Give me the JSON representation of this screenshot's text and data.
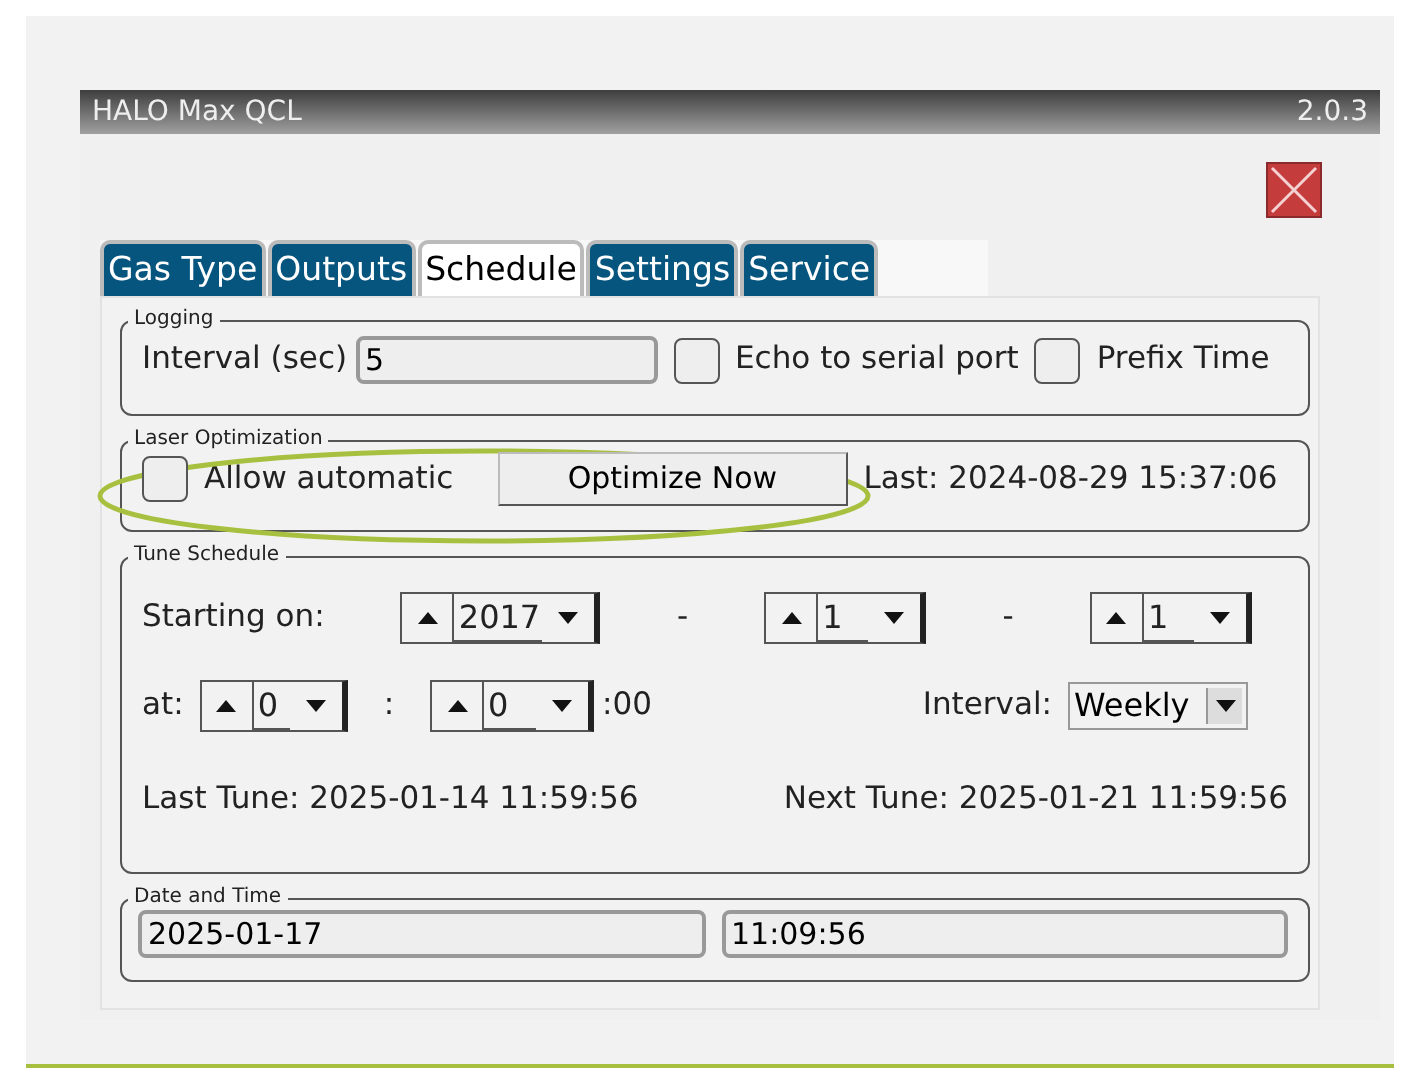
{
  "window": {
    "title": "HALO Max QCL",
    "version": "2.0.3"
  },
  "tabs": [
    {
      "label": "Gas Type",
      "selected": false
    },
    {
      "label": "Outputs",
      "selected": false
    },
    {
      "label": "Schedule",
      "selected": true
    },
    {
      "label": "Settings",
      "selected": false
    },
    {
      "label": "Service",
      "selected": false
    }
  ],
  "logging": {
    "title": "Logging",
    "interval_label": "Interval (sec)",
    "interval_value": "5",
    "options": [
      {
        "label": "Echo to serial port",
        "checked": false
      },
      {
        "label": "Prefix Time",
        "checked": false
      }
    ]
  },
  "laser_optimization": {
    "title": "Laser Optimization",
    "allow_automatic": {
      "label": "Allow automatic",
      "checked": false
    },
    "button": "Optimize Now",
    "last": "Last: 2024-08-29 15:37:06",
    "circled": true
  },
  "tune_schedule": {
    "title": "Tune Schedule",
    "starting_label": "Starting on:",
    "date_spinners": [
      "2017",
      "1",
      "1"
    ],
    "date_separators": [
      "-",
      "-"
    ],
    "at_label": "at:",
    "time_spinners": [
      "0",
      "0"
    ],
    "time_separator": ":",
    "seconds": ":00",
    "interval_label": "Interval:",
    "interval_value": "Weekly",
    "last_tune": "Last Tune: 2025-01-14 11:59:56",
    "next_tune": "Next Tune: 2025-01-21 11:59:56"
  },
  "date_time": {
    "title": "Date and Time",
    "date": "2025-01-17",
    "time": "11:09:56"
  }
}
